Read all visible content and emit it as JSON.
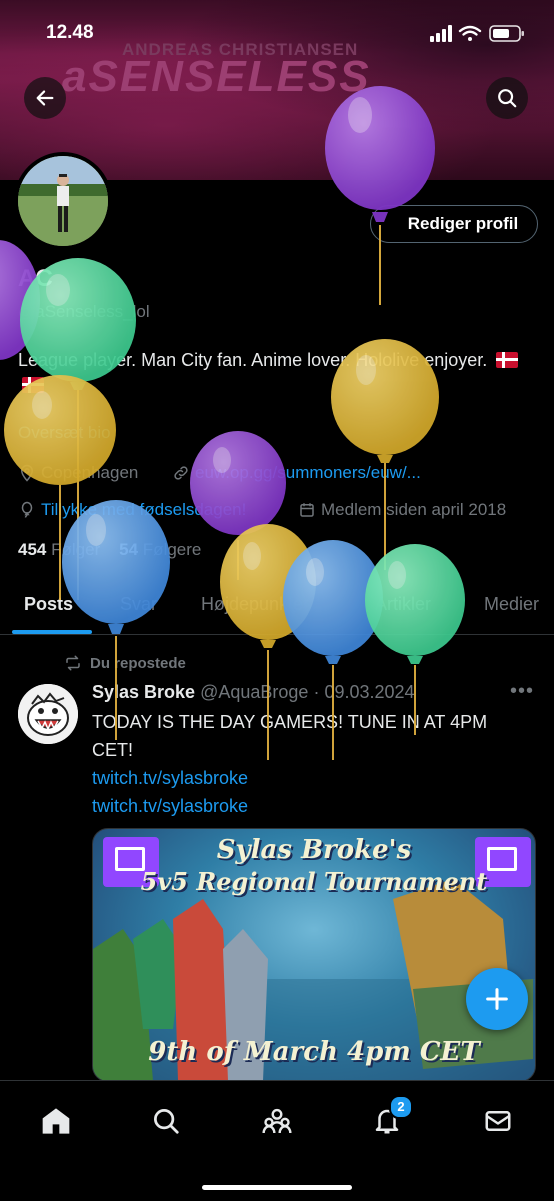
{
  "status_bar": {
    "time": "12.48"
  },
  "banner": {
    "name_text": "ANDREAS CHRISTIANSEN",
    "logo_text": "aSENSELESS"
  },
  "profile": {
    "edit_button": "Rediger profil",
    "display_name": "AC",
    "handle": "@aSenseless_lol",
    "bio": "League player. Man City fan. Anime lover. Hololive enjoyer.",
    "translate_bio": "Oversæt bio",
    "location": "Copenhagen",
    "link": "euw.op.gg/summoners/euw/...",
    "birthday": "Tillykke med fødselsdagen!",
    "joined": "Medlem siden april 2018",
    "following_count": "454",
    "following_label": "Følger",
    "followers_count": "54",
    "followers_label": "Følgere"
  },
  "tabs": [
    {
      "label": "Posts",
      "active": true
    },
    {
      "label": "Svar"
    },
    {
      "label": "Højdepunkter"
    },
    {
      "label": "Artikler"
    },
    {
      "label": "Medier"
    }
  ],
  "post": {
    "repost_label": "Du repostede",
    "author": "Sylas Broke",
    "handle": "@AquaBroge",
    "separator": "·",
    "date": "09.03.2024",
    "text": "TODAY IS THE DAY GAMERS! TUNE IN AT 4PM CET!",
    "link1": "twitch.tv/sylasbroke",
    "link2": "twitch.tv/sylasbroke",
    "media": {
      "title_line1": "Sylas Broke's",
      "title_line2": "5v5 Regional Tournament",
      "date_line": "9th of March 4pm CET"
    }
  },
  "bottom_nav": {
    "notifications_badge": "2"
  },
  "colors": {
    "accent": "#1d9bf0",
    "background": "#000000",
    "muted": "#71767b"
  }
}
